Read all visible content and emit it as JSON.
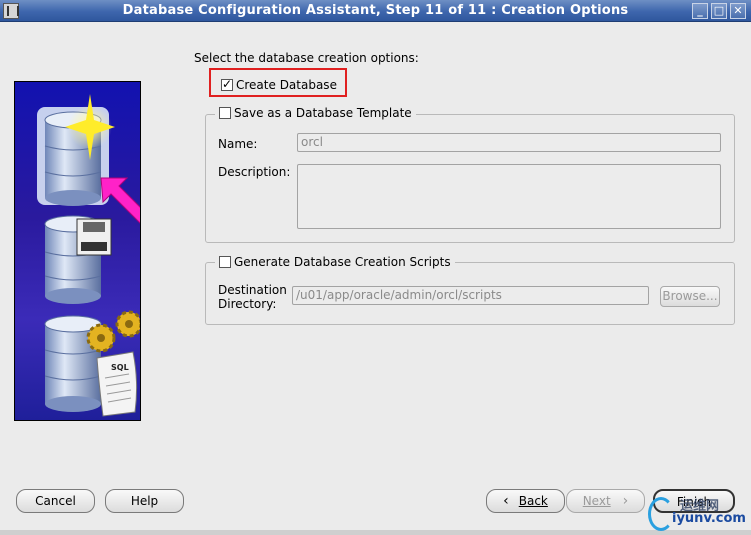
{
  "window": {
    "title": "Database Configuration Assistant, Step 11 of 11 : Creation Options",
    "controls": {
      "minimize": "_",
      "maximize": "□",
      "close": "✕"
    }
  },
  "intro": "Select the database creation options:",
  "create_database": {
    "label": "Create Database",
    "checked": true
  },
  "template_group": {
    "label": "Save as a Database Template",
    "checked": false,
    "name_label": "Name:",
    "name_value": "orcl",
    "description_label": "Description:",
    "description_value": ""
  },
  "scripts_group": {
    "label": "Generate Database Creation Scripts",
    "checked": false,
    "destination_label_line1": "Destination",
    "destination_label_line2": "Directory:",
    "destination_value": "/u01/app/oracle/admin/orcl/scripts",
    "browse_label": "Browse..."
  },
  "buttons": {
    "cancel": "Cancel",
    "help": "Help",
    "back_icon": "‹",
    "back": "Back",
    "next": "Next",
    "next_icon": "›",
    "finish": "Finish"
  },
  "watermark": {
    "cn": "运维网",
    "url": "iyunv.com"
  },
  "illustration": {
    "icons": [
      "database-star-icon",
      "database-floppy-icon",
      "database-sql-gears-icon",
      "pink-arrow-icon"
    ],
    "sql_text": "SQL"
  },
  "colors": {
    "titlebar": "#3e66ad",
    "highlight": "#e02020",
    "illustration_bg": "#1212b0"
  }
}
